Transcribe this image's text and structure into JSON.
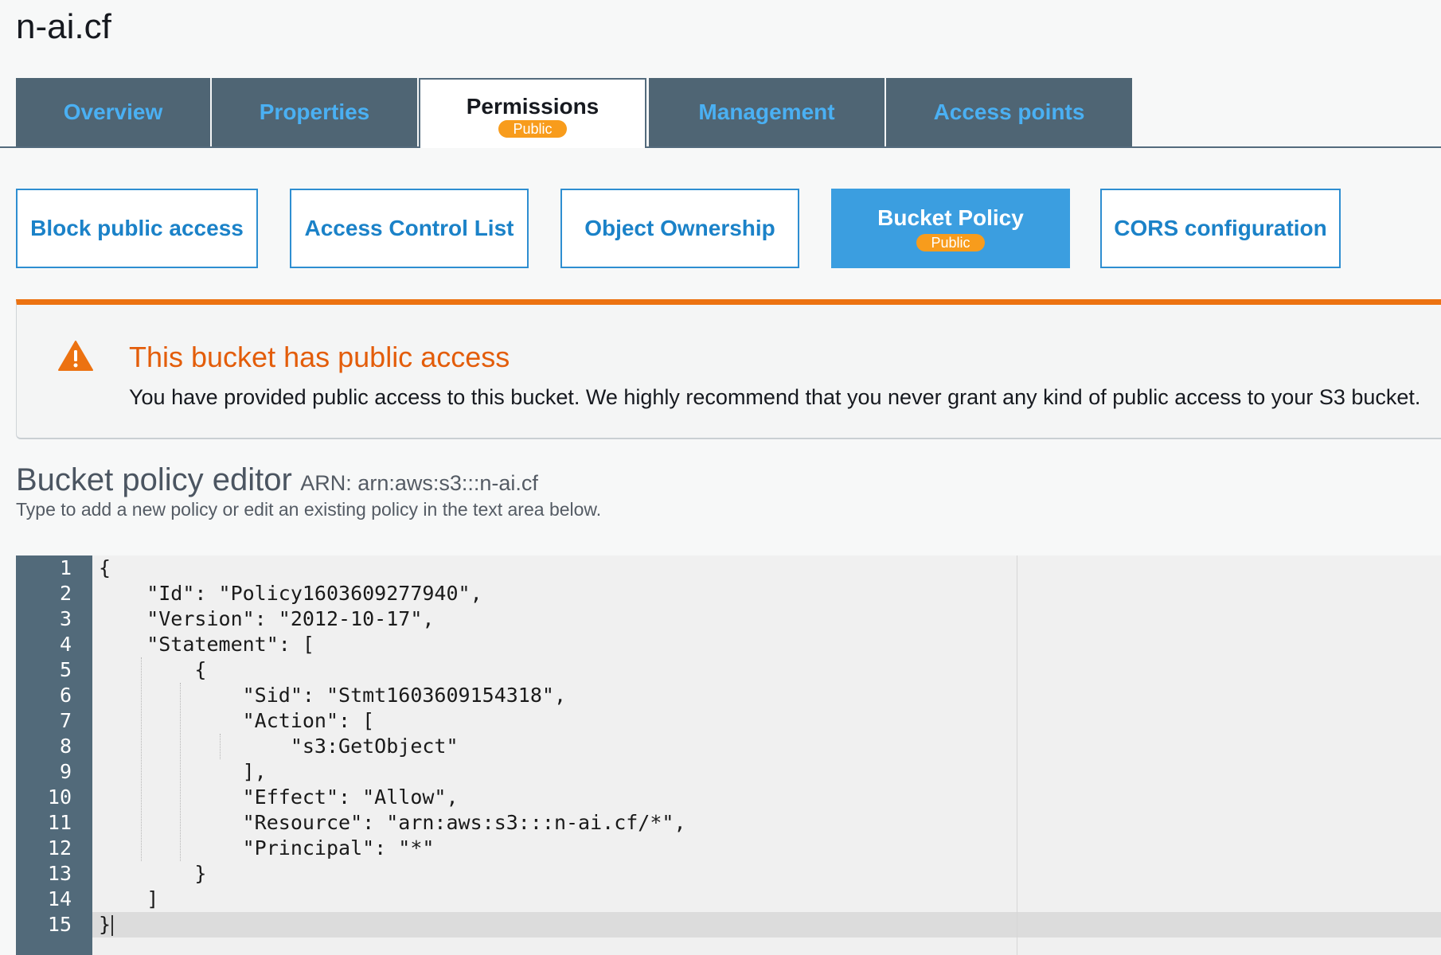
{
  "header": {
    "bucket_name": "n-ai.cf"
  },
  "main_tabs": [
    {
      "label": "Overview"
    },
    {
      "label": "Properties"
    },
    {
      "label": "Permissions",
      "badge": "Public"
    },
    {
      "label": "Management"
    },
    {
      "label": "Access points"
    }
  ],
  "active_main_tab": "Permissions",
  "sub_tabs": [
    {
      "label": "Block public access"
    },
    {
      "label": "Access Control List"
    },
    {
      "label": "Object Ownership"
    },
    {
      "label": "Bucket Policy",
      "badge": "Public"
    },
    {
      "label": "CORS configuration"
    }
  ],
  "active_sub_tab": "Bucket Policy",
  "alert": {
    "title": "This bucket has public access",
    "text": "You have provided public access to this bucket. We highly recommend that you never grant any kind of public access to your S3 bucket.",
    "icon": "warning-icon"
  },
  "editor": {
    "title": "Bucket policy editor",
    "arn": "ARN: arn:aws:s3:::n-ai.cf",
    "subtitle": "Type to add a new policy or edit an existing policy in the text area below.",
    "lines": [
      "{",
      "    \"Id\": \"Policy1603609277940\",",
      "    \"Version\": \"2012-10-17\",",
      "    \"Statement\": [",
      "        {",
      "            \"Sid\": \"Stmt1603609154318\",",
      "            \"Action\": [",
      "                \"s3:GetObject\"",
      "            ],",
      "            \"Effect\": \"Allow\",",
      "            \"Resource\": \"arn:aws:s3:::n-ai.cf/*\",",
      "            \"Principal\": \"*\"",
      "        }",
      "    ]",
      "}"
    ],
    "line_numbers": [
      "1",
      "2",
      "3",
      "4",
      "5",
      "6",
      "7",
      "8",
      "9",
      "10",
      "11",
      "12",
      "13",
      "14",
      "15"
    ],
    "active_line": 15
  },
  "colors": {
    "tab_background": "#4f6574",
    "tab_text": "#4ab0f3",
    "badge": "#f89c1c",
    "sub_tab_border": "#2e8ed1",
    "sub_tab_active": "#3b9ee0",
    "alert_accent": "#ec7211"
  }
}
